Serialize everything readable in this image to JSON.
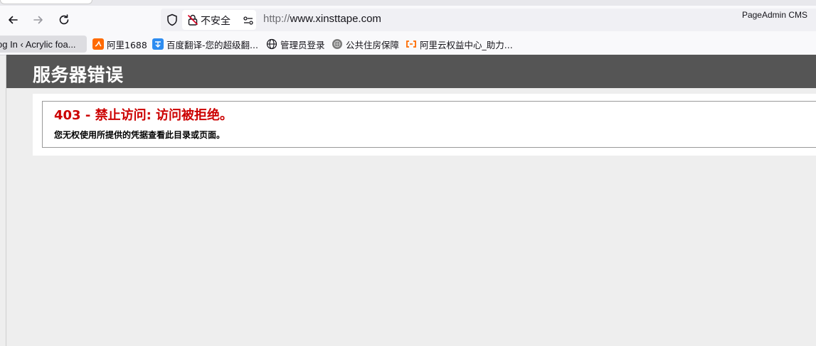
{
  "browser": {
    "security_label": "不安全",
    "url_scheme": "http://",
    "url_host": "www.xinsttape.com",
    "corner_label": "PageAdmin CMS",
    "icons": [
      "back-icon",
      "forward-icon",
      "reload-icon",
      "shield-icon",
      "lock-icon",
      "permissions-icon"
    ]
  },
  "bookmarks": [
    {
      "label": "og In ‹ Acrylic foa...",
      "icon": "page-icon"
    },
    {
      "label": "阿里1688",
      "icon": "alibaba-1688-icon"
    },
    {
      "label": "百度翻译-您的超级翻...",
      "icon": "baidu-translate-icon"
    },
    {
      "label": "管理员登录",
      "icon": "globe-icon"
    },
    {
      "label": "公共住房保障",
      "icon": "emblem-icon"
    },
    {
      "label": "阿里云权益中心_助力...",
      "icon": "aliyun-icon"
    }
  ],
  "page": {
    "header_title": "服务器错误",
    "error_title": "403 - 禁止访问: 访问被拒绝。",
    "error_message": "您无权使用所提供的凭据查看此目录或页面。"
  },
  "colors": {
    "header_bg": "#555555",
    "error_red": "#cc0000",
    "page_bg": "#eeeeee"
  }
}
